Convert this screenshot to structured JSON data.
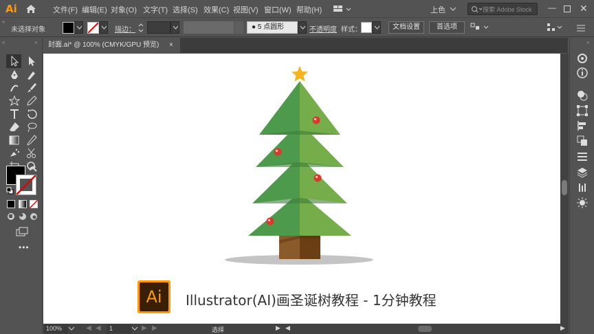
{
  "app": {
    "logo_text": "Ai"
  },
  "menu": {
    "items": [
      "文件(F)",
      "编辑(E)",
      "对象(O)",
      "文字(T)",
      "选择(S)",
      "效果(C)",
      "视图(V)",
      "窗口(W)",
      "帮助(H)"
    ],
    "workspace": "上色",
    "search_placeholder": "搜索 Adobe Stock"
  },
  "control": {
    "no_selection": "未选择对象",
    "stroke_label": "描边：",
    "brush_label": "5 点圆形",
    "opacity_label": "不透明度",
    "style_label": "样式：",
    "doc_setup": "文档设置",
    "preferences": "首选项"
  },
  "tab": {
    "title": "封面.ai* @ 100% (CMYK/GPU 预览)",
    "close": "×"
  },
  "artwork": {
    "caption": "Illustrator(AI)画圣诞树教程 - 1分钟教程",
    "badge_text": "Ai",
    "colors": {
      "tree_dark": "#4e9a4c",
      "tree_light": "#74ad4a",
      "trunk_dark": "#8b5a2b",
      "trunk_light": "#6b3e14",
      "star": "#f5b41b",
      "ornament": "#d93a2e",
      "shadow": "#c4c4c4",
      "badge_bg": "#3a1f05",
      "badge_fg": "#ff9a00"
    }
  },
  "status": {
    "zoom": "100%",
    "page": "1",
    "mode": "选择"
  }
}
